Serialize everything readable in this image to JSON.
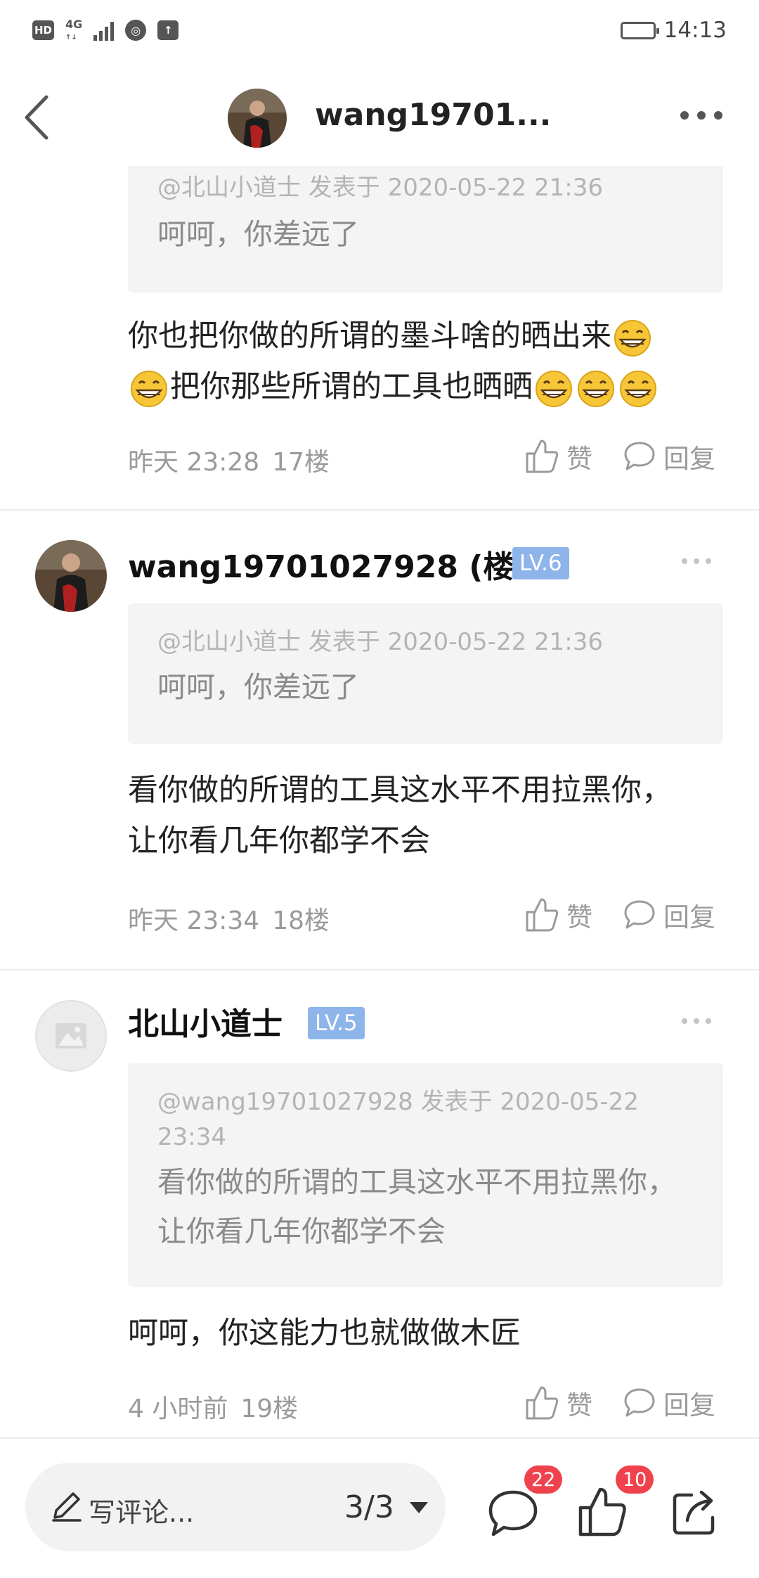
{
  "status_bar": {
    "hd": "HD",
    "net_top": "4G",
    "net_bottom": "↑↓",
    "time": "14:13",
    "battery_level": 0.45
  },
  "nav": {
    "title": "wang19701...",
    "back_icon": "chevron-left-icon",
    "more_icon": "more-horizontal-icon"
  },
  "comments": [
    {
      "quote_meta": "@北山小道士 发表于 2020-05-22 21:36",
      "quote_text": "呵呵，你差远了",
      "body_line1": "你也把你做的所谓的墨斗啥的晒出来",
      "body_line2": "把你那些所谓的工具也晒晒",
      "time": "昨天 23:28",
      "floor": "17楼",
      "like_label": "赞",
      "reply_label": "回复"
    },
    {
      "username": "wang19701027928 (楼...",
      "level": "LV.6",
      "quote_meta": "@北山小道士 发表于 2020-05-22 21:36",
      "quote_text": "呵呵，你差远了",
      "body": "看你做的所谓的工具这水平不用拉黑你，让你看几年你都学不会",
      "time": "昨天 23:34",
      "floor": "18楼",
      "like_label": "赞",
      "reply_label": "回复"
    },
    {
      "username": "北山小道士",
      "level": "LV.5",
      "quote_meta": "@wang19701027928 发表于 2020-05-22 23:34",
      "quote_text": "看你做的所谓的工具这水平不用拉黑你，让你看几年你都学不会",
      "body": "呵呵，你这能力也就做做木匠",
      "time": "4 小时前",
      "floor": "19楼",
      "like_label": "赞",
      "reply_label": "回复"
    }
  ],
  "bottom_bar": {
    "input_placeholder": "写评论...",
    "page": "3/3",
    "comment_count": "22",
    "like_count": "10"
  },
  "colors": {
    "level_badge": "#8db5ea",
    "count_badge": "#f0424c",
    "quote_bg": "#f4f4f4"
  }
}
